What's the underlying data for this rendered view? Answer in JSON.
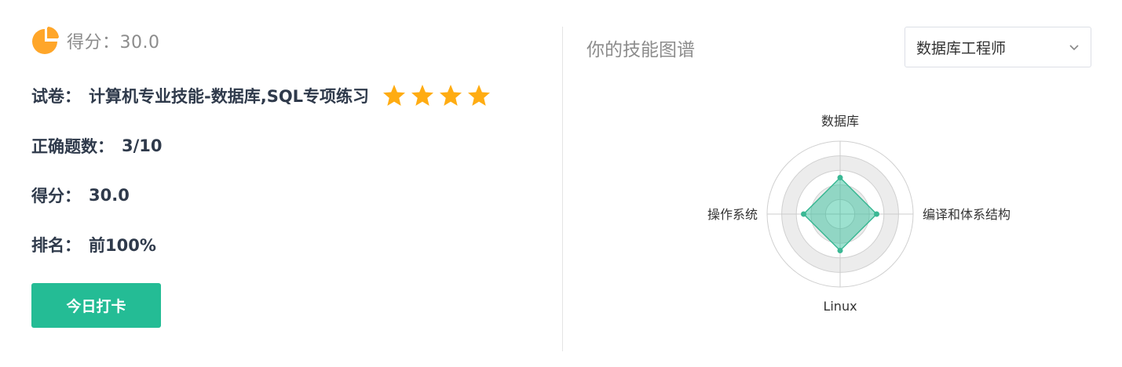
{
  "summary": {
    "score_header": "得分：30.0",
    "paper_label": "试卷：",
    "paper_value": "计算机专业技能-数据库,SQL专项练习",
    "stars_filled": 4,
    "stars_total": 4,
    "correct_label": "正确题数：",
    "correct_value": "3/10",
    "score_label": "得分：",
    "score_value": "30.0",
    "rank_label": "排名：",
    "rank_value": "前100%",
    "checkin_button": "今日打卡"
  },
  "skills": {
    "title": "你的技能图谱",
    "role_select": "数据库工程师"
  },
  "chart_data": {
    "type": "radar",
    "indicators": [
      "数据库",
      "编译和体系结构",
      "Linux",
      "操作系统"
    ],
    "values": [
      0.5,
      0.5,
      0.5,
      0.5
    ],
    "max": 1.0
  },
  "colors": {
    "accent": "#24bc95",
    "star": "#ffac12",
    "pie_icon": "#ffa629",
    "radar_fill": "#24bc95",
    "radar_line": "#3ab894"
  }
}
